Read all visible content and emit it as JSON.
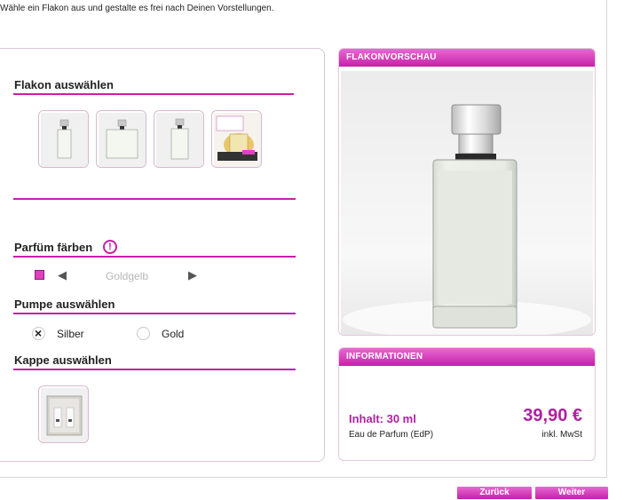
{
  "intro_text": "Wähle ein Flakon aus und gestalte es frei nach Deinen Vorstellungen.",
  "flakon": {
    "title": "Flakon auswählen",
    "thumbnails": [
      "flakon-slim",
      "flakon-square",
      "flakon-tall",
      "flakon-gift-set"
    ]
  },
  "color": {
    "title": "Parfüm färben",
    "info_icon": "!",
    "selected": "Goldgelb",
    "swatch_color": "#e040c0",
    "prev_icon": "◀",
    "next_icon": "▶"
  },
  "pump": {
    "title": "Pumpe auswählen",
    "options": [
      {
        "label": "Silber",
        "checked": true
      },
      {
        "label": "Gold",
        "checked": false
      }
    ]
  },
  "cap": {
    "title": "Kappe auswählen",
    "thumbnails": [
      "cap-silver"
    ]
  },
  "preview": {
    "header": "FLAKONVORSCHAU"
  },
  "info": {
    "header": "INFORMATIONEN",
    "content_label": "Inhalt: 30 ml",
    "price": "39,90 €",
    "type": "Eau de Parfum (EdP)",
    "vat": "inkl. MwSt"
  },
  "nav": {
    "back": "Zurück",
    "next": "Weiter"
  },
  "colors": {
    "accent": "#c81fa8",
    "price": "#b020a0"
  }
}
